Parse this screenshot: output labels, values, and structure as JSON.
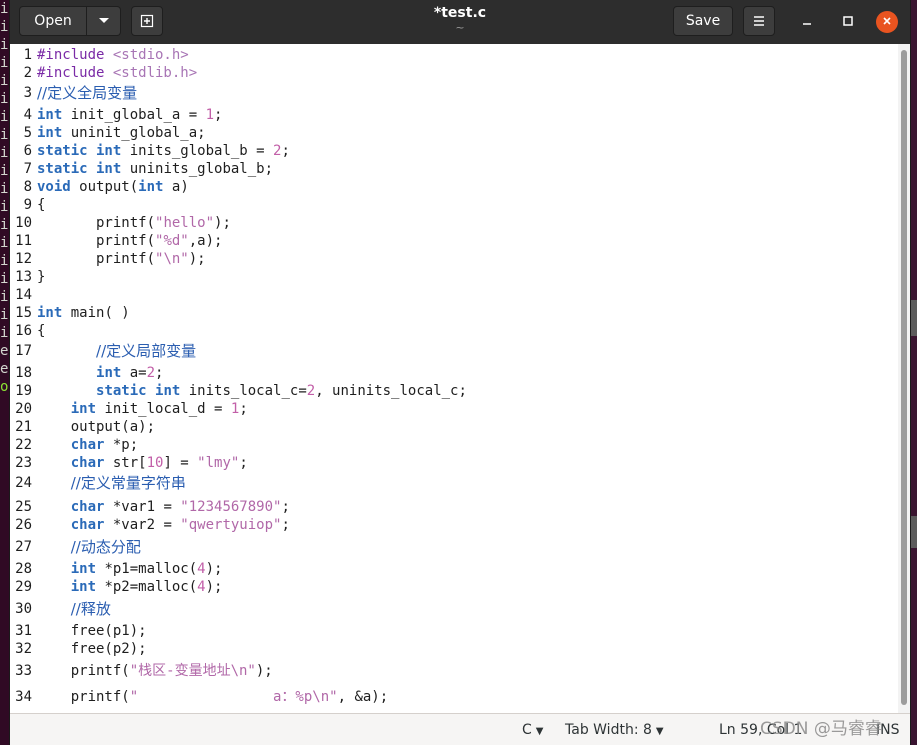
{
  "background_terminal": {
    "lines": [
      "ir",
      "ir",
      "ir",
      "ir",
      "ir",
      "ir",
      "ir",
      "ir",
      "ir",
      "ir",
      "ir",
      "ir",
      "ir",
      "ir",
      "ir",
      "ir",
      "ir",
      "ir",
      "ir",
      "es",
      "es",
      "ou"
    ]
  },
  "header": {
    "open_label": "Open",
    "title": "*test.c",
    "subtitle": "~",
    "save_label": "Save"
  },
  "editor": {
    "lines": [
      {
        "n": "1",
        "t": [
          [
            "pp",
            "#include "
          ],
          [
            "inc",
            "<stdio.h>"
          ]
        ]
      },
      {
        "n": "2",
        "t": [
          [
            "pp",
            "#include "
          ],
          [
            "inc",
            "<stdlib.h>"
          ]
        ]
      },
      {
        "n": "3",
        "t": [
          [
            "cm",
            "//定义全局变量"
          ]
        ]
      },
      {
        "n": "4",
        "t": [
          [
            "kw",
            "int"
          ],
          [
            "",
            "init_global_a = "
          ],
          [
            "num",
            "1"
          ],
          [
            "",
            ";"
          ]
        ]
      },
      {
        "n": "5",
        "t": [
          [
            "kw",
            "int"
          ],
          [
            "",
            "uninit_global_a;"
          ]
        ]
      },
      {
        "n": "6",
        "t": [
          [
            "kw",
            "static int"
          ],
          [
            "",
            "inits_global_b = "
          ],
          [
            "num",
            "2"
          ],
          [
            "",
            ";"
          ]
        ]
      },
      {
        "n": "7",
        "t": [
          [
            "kw",
            "static int"
          ],
          [
            "",
            "uninits_global_b;"
          ]
        ]
      },
      {
        "n": "8",
        "t": [
          [
            "kw",
            "void"
          ],
          [
            "",
            "output("
          ],
          [
            "kw",
            "int"
          ],
          [
            "",
            " a)"
          ]
        ]
      },
      {
        "n": "9",
        "t": [
          [
            "",
            "{"
          ]
        ]
      },
      {
        "n": "10",
        "t": [
          [
            "",
            "       printf("
          ],
          [
            "str",
            "\"hello\""
          ],
          [
            "",
            ");"
          ]
        ]
      },
      {
        "n": "11",
        "t": [
          [
            "",
            "       printf("
          ],
          [
            "str",
            "\"%d\""
          ],
          [
            "",
            ",a);"
          ]
        ]
      },
      {
        "n": "12",
        "t": [
          [
            "",
            "       printf("
          ],
          [
            "str",
            "\"\\n\""
          ],
          [
            "",
            ");"
          ]
        ]
      },
      {
        "n": "13",
        "t": [
          [
            "",
            "}"
          ]
        ]
      },
      {
        "n": "14",
        "t": []
      },
      {
        "n": "15",
        "t": [
          [
            "kw",
            "int"
          ],
          [
            "",
            "main( )"
          ]
        ]
      },
      {
        "n": "16",
        "t": [
          [
            "",
            "{"
          ]
        ]
      },
      {
        "n": "17",
        "t": [
          [
            "",
            "       "
          ],
          [
            "cm",
            "//定义局部变量"
          ]
        ]
      },
      {
        "n": "18",
        "t": [
          [
            "",
            "       "
          ],
          [
            "kw",
            "int"
          ],
          [
            "",
            " a="
          ],
          [
            "num",
            "2"
          ],
          [
            "",
            ";"
          ]
        ]
      },
      {
        "n": "19",
        "t": [
          [
            "",
            "       "
          ],
          [
            "kw",
            "static int"
          ],
          [
            "",
            " inits_local_c="
          ],
          [
            "num",
            "2"
          ],
          [
            "",
            ", uninits_local_c;"
          ]
        ]
      },
      {
        "n": "20",
        "t": [
          [
            "",
            "    "
          ],
          [
            "kw",
            "int"
          ],
          [
            "",
            " init_local_d = "
          ],
          [
            "num",
            "1"
          ],
          [
            "",
            ";"
          ]
        ]
      },
      {
        "n": "21",
        "t": [
          [
            "",
            "    output(a);"
          ]
        ]
      },
      {
        "n": "22",
        "t": [
          [
            "",
            "    "
          ],
          [
            "kw",
            "char"
          ],
          [
            "",
            " *p;"
          ]
        ]
      },
      {
        "n": "23",
        "t": [
          [
            "",
            "    "
          ],
          [
            "kw",
            "char"
          ],
          [
            "",
            " str["
          ],
          [
            "num",
            "10"
          ],
          [
            "",
            "] = "
          ],
          [
            "str",
            "\"lmy\""
          ],
          [
            "",
            ";"
          ]
        ]
      },
      {
        "n": "24",
        "t": [
          [
            "",
            "    "
          ],
          [
            "cm",
            "//定义常量字符串"
          ]
        ]
      },
      {
        "n": "25",
        "t": [
          [
            "",
            "    "
          ],
          [
            "kw",
            "char"
          ],
          [
            "",
            " *var1 = "
          ],
          [
            "str",
            "\"1234567890\""
          ],
          [
            "",
            ";"
          ]
        ]
      },
      {
        "n": "26",
        "t": [
          [
            "",
            "    "
          ],
          [
            "kw",
            "char"
          ],
          [
            "",
            " *var2 = "
          ],
          [
            "str",
            "\"qwertyuiop\""
          ],
          [
            "",
            ";"
          ]
        ]
      },
      {
        "n": "27",
        "t": [
          [
            "",
            "    "
          ],
          [
            "cm",
            "//动态分配"
          ]
        ]
      },
      {
        "n": "28",
        "t": [
          [
            "",
            "    "
          ],
          [
            "kw",
            "int"
          ],
          [
            "",
            " *p1=malloc("
          ],
          [
            "num",
            "4"
          ],
          [
            "",
            ");"
          ]
        ]
      },
      {
        "n": "29",
        "t": [
          [
            "",
            "    "
          ],
          [
            "kw",
            "int"
          ],
          [
            "",
            " *p2=malloc("
          ],
          [
            "num",
            "4"
          ],
          [
            "",
            ");"
          ]
        ]
      },
      {
        "n": "30",
        "t": [
          [
            "",
            "    "
          ],
          [
            "cm",
            "//释放"
          ]
        ]
      },
      {
        "n": "31",
        "t": [
          [
            "",
            "    free(p1);"
          ]
        ]
      },
      {
        "n": "32",
        "t": [
          [
            "",
            "    free(p2);"
          ]
        ]
      },
      {
        "n": "33",
        "t": [
          [
            "",
            "    printf("
          ],
          [
            "str",
            "\"栈区-变量地址\\n\""
          ],
          [
            "",
            ");"
          ]
        ]
      },
      {
        "n": "34",
        "t": [
          [
            "",
            "    printf("
          ],
          [
            "str",
            "\"                a：%p\\n\""
          ],
          [
            "",
            ", &a);"
          ]
        ]
      }
    ]
  },
  "statusbar": {
    "language": "C",
    "tab_width": "Tab Width: 8",
    "position": "Ln 59, Col 1",
    "mode": "INS"
  },
  "watermark": "CSDN @马睿睿"
}
